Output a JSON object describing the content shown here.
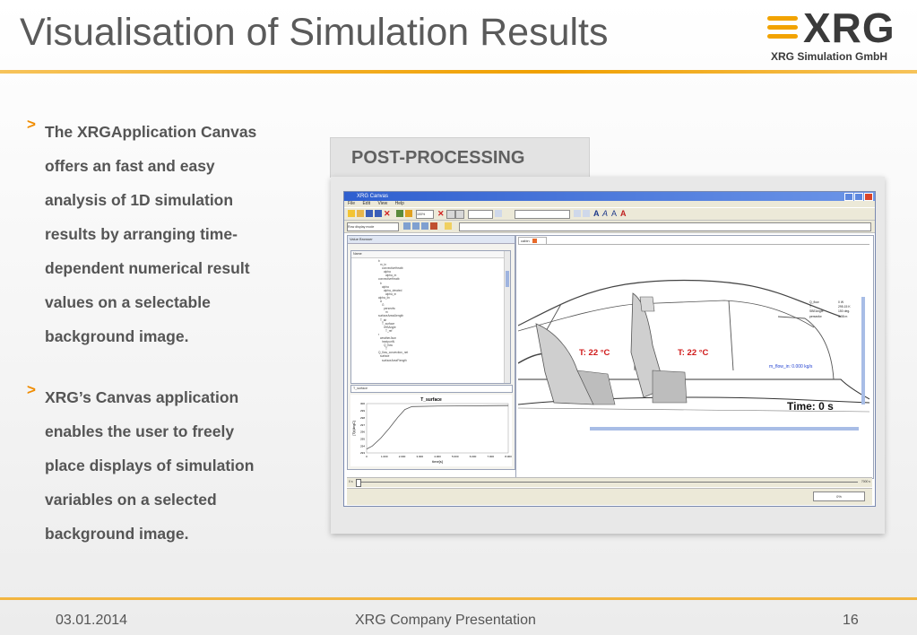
{
  "slide": {
    "title": "Visualisation of Simulation Results",
    "logo_word": "XRG",
    "logo_sub": "XRG Simulation GmbH",
    "accent": "#f2a300",
    "bullets": [
      {
        "marker": ">",
        "lines": [
          "The XRGApplication Canvas",
          "offers an fast and easy",
          "analysis of 1D simulation",
          "results by arranging time-",
          "dependent numerical result",
          "values on a selectable",
          "background image."
        ]
      },
      {
        "marker": ">",
        "lines": [
          "XRG’s Canvas application",
          "enables the user to freely",
          "place displays of simulation",
          "variables on a selected",
          "background image."
        ]
      }
    ],
    "panel_tab": "POST-PROCESSING",
    "footer": {
      "date": "03.01.2014",
      "center": "XRG Company Presentation",
      "page": "16"
    }
  },
  "app": {
    "window_title": "XRG Canvas",
    "menu": [
      "File",
      "Edit",
      "View",
      "Help"
    ],
    "zoom_value": "100%",
    "display_mode": "Row display mode",
    "value_browser_label": "Value Browser",
    "tree_header": "Name",
    "tree_items": [
      "b",
      "m_in",
      "convectiveHeatb",
      "alpha",
      "alpha_m",
      "convectiveHeatb",
      "b",
      "alpha",
      "alpha_derated",
      "alpha_in",
      "alpha_lin",
      "A",
      "G",
      "persecfw",
      "m",
      "surfaceAreaAlength",
      "T_air",
      "T_surface",
      "rHBAngle",
      "T_ref",
      "r",
      "weatherJson",
      "heatportN",
      "Q_flow",
      "T",
      "Q_flow_convection_net",
      "surface",
      "surfaceAreaFlength"
    ],
    "search_value": "T_surface",
    "plot": {
      "title": "T_surface",
      "xlabel": "time[s]",
      "ylabel": "[T]c[degC]",
      "x_ticks": [
        "0",
        "1.000",
        "2.000",
        "3.000",
        "4.000",
        "5.000",
        "6.000",
        "7.000",
        "8.000"
      ],
      "y_ticks": [
        "300",
        "299",
        "298",
        "297",
        "296",
        "295",
        "294",
        "293"
      ]
    },
    "canvas_tab": "cabin",
    "temp_front": "T: 22 °C",
    "temp_rear": "T: 22 °C",
    "flow_text": "m_flow_in: 0.000 kg/s",
    "time_text": "Time: 0 s",
    "var_table": [
      [
        "Q_flow",
        "0 W"
      ],
      [
        "T",
        "295.15 K"
      ],
      [
        "SBEAngle",
        "150 deg."
      ],
      [
        "persecfw",
        "4.08 m"
      ]
    ],
    "slider_start": "0 s",
    "slider_end": "7000 s",
    "status_value": "0%"
  }
}
